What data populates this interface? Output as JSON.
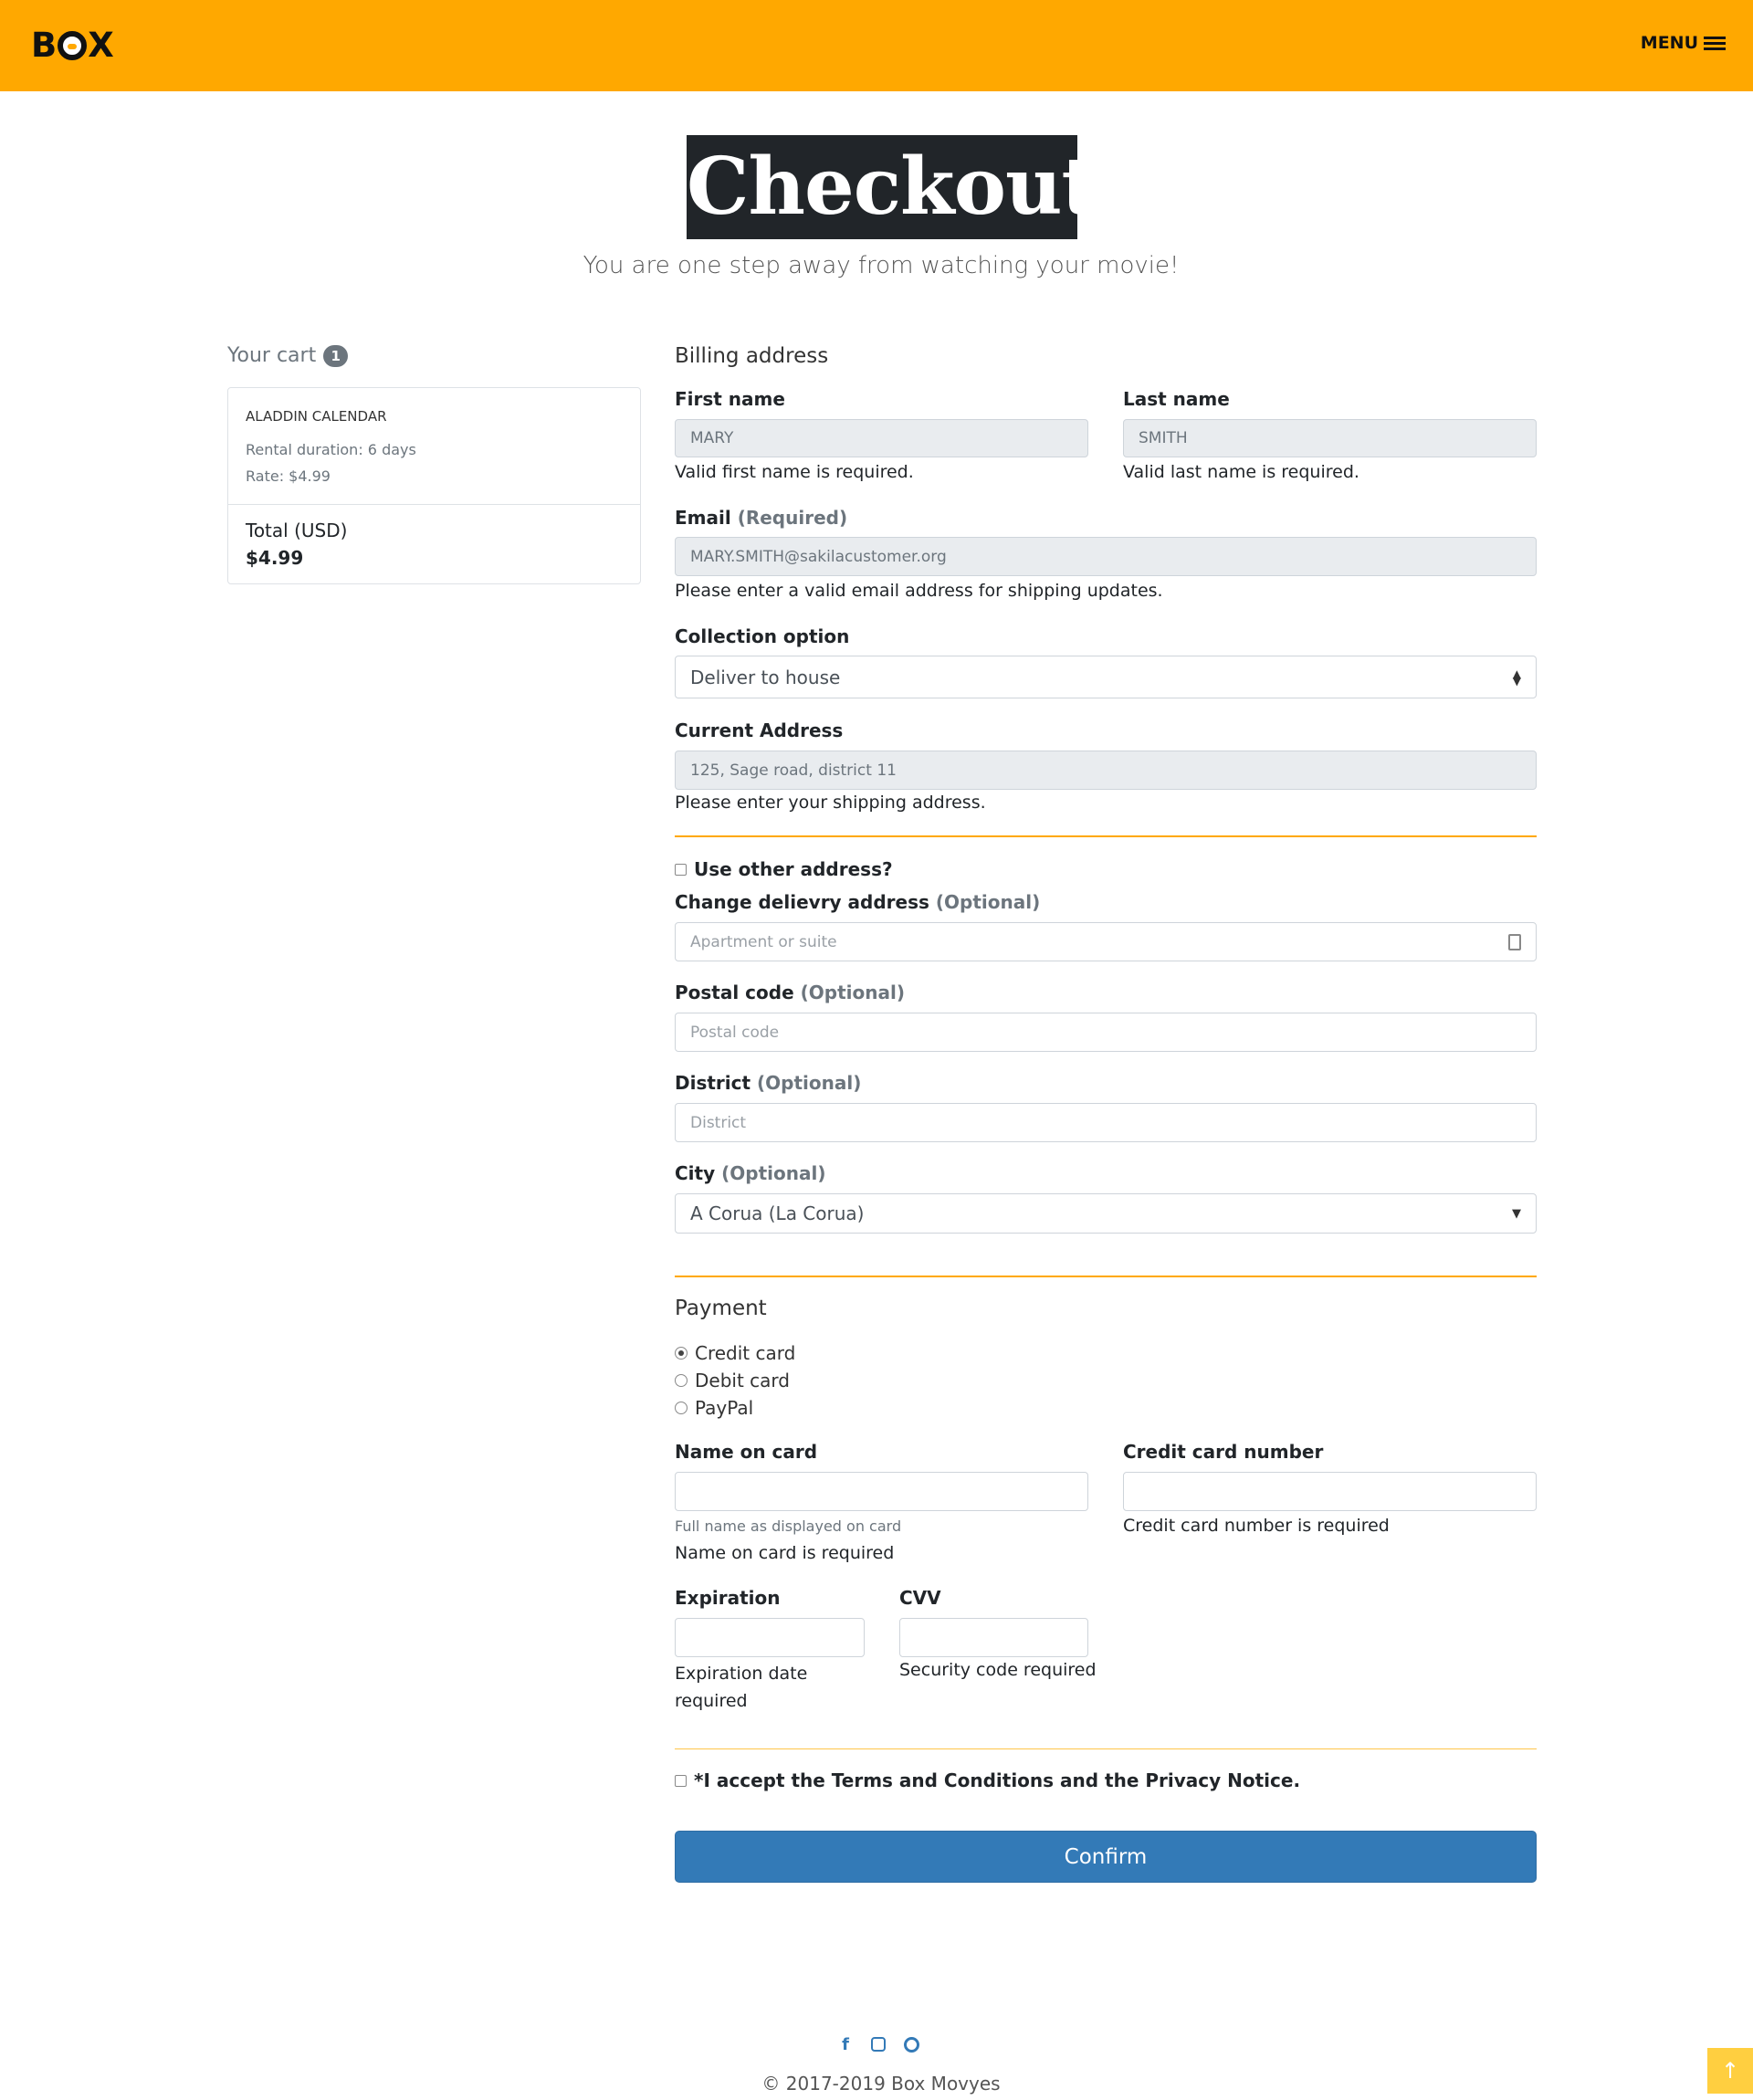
{
  "header": {
    "logo": "BOX",
    "menu_label": "MENU"
  },
  "hero": {
    "title": "Checkout",
    "subtitle": "You are one step away from watching your movie!"
  },
  "cart": {
    "title": "Your cart",
    "count": "1",
    "item": {
      "name": "ALADDIN CALENDAR",
      "duration": "Rental duration: 6 days",
      "rate": "Rate: $4.99"
    },
    "total_label": "Total (USD)",
    "total_value": "$4.99"
  },
  "billing": {
    "title": "Billing address",
    "first_name": {
      "label": "First name",
      "value": "MARY",
      "help": "Valid first name is required."
    },
    "last_name": {
      "label": "Last name",
      "value": "SMITH",
      "help": "Valid last name is required."
    },
    "email": {
      "label": "Email",
      "qualifier": "(Required)",
      "value": "MARY.SMITH@sakilacustomer.org",
      "help": "Please enter a valid email address for shipping updates."
    },
    "collection": {
      "label": "Collection option",
      "value": "Deliver to house"
    },
    "address": {
      "label": "Current Address",
      "value": "125, Sage road, district 11",
      "help": "Please enter your shipping address."
    },
    "other_address": {
      "label": "Use other address?"
    },
    "change_address": {
      "label": "Change delievry address",
      "qualifier": "(Optional)",
      "placeholder": "Apartment or suite"
    },
    "postal": {
      "label": "Postal code",
      "qualifier": "(Optional)",
      "placeholder": "Postal code"
    },
    "district": {
      "label": "District",
      "qualifier": "(Optional)",
      "placeholder": "District"
    },
    "city": {
      "label": "City",
      "qualifier": "(Optional)",
      "value": "A Corua (La Corua)"
    }
  },
  "payment": {
    "title": "Payment",
    "methods": [
      "Credit card",
      "Debit card",
      "PayPal"
    ],
    "selected": "Credit card",
    "name_on_card": {
      "label": "Name on card",
      "hint": "Full name as displayed on card",
      "help": "Name on card is required"
    },
    "card_number": {
      "label": "Credit card number",
      "help": "Credit card number is required"
    },
    "expiration": {
      "label": "Expiration",
      "help": "Expiration date required"
    },
    "cvv": {
      "label": "CVV",
      "help": "Security code required"
    }
  },
  "terms": {
    "label": "*I accept the Terms and Conditions and the Privacy Notice."
  },
  "confirm_label": "Confirm",
  "footer": {
    "copyright": "© 2017-2019 Box Movyes"
  },
  "colors": {
    "brand": "#ffa800",
    "button": "#337ab7"
  }
}
